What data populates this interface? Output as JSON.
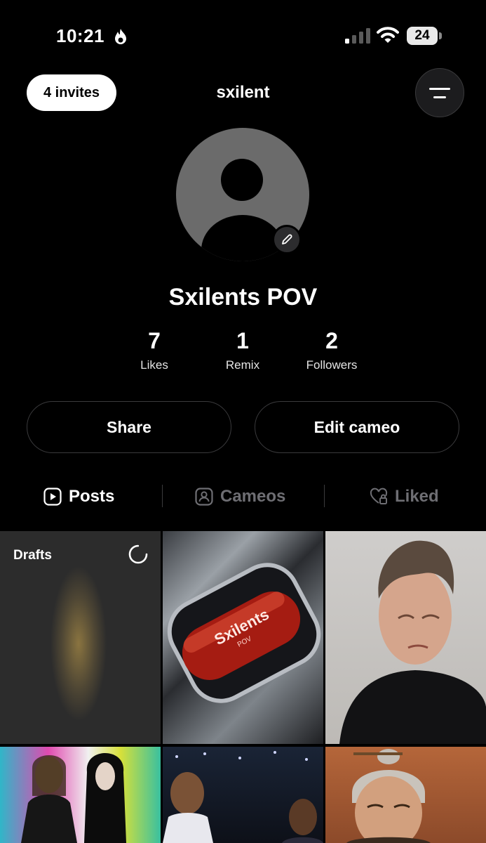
{
  "status_bar": {
    "time": "10:21",
    "battery": "24"
  },
  "header": {
    "invites_label": "4 invites",
    "username": "sxilent"
  },
  "profile": {
    "display_name": "Sxilents POV",
    "stats": [
      {
        "value": "7",
        "label": "Likes"
      },
      {
        "value": "1",
        "label": "Remix"
      },
      {
        "value": "2",
        "label": "Followers"
      }
    ]
  },
  "actions": {
    "share_label": "Share",
    "edit_cameo_label": "Edit cameo"
  },
  "tabs": [
    {
      "label": "Posts",
      "icon": "play-square-icon",
      "active": true
    },
    {
      "label": "Cameos",
      "icon": "person-portrait-icon",
      "active": false
    },
    {
      "label": "Liked",
      "icon": "heart-lock-icon",
      "active": false
    }
  ],
  "grid": {
    "drafts_label": "Drafts",
    "pill_text": "Sxilents",
    "pill_subtext": "POV"
  },
  "colors": {
    "background": "#000000",
    "inactive_tab": "#6e6e73",
    "button_border": "#3a3a3c"
  }
}
